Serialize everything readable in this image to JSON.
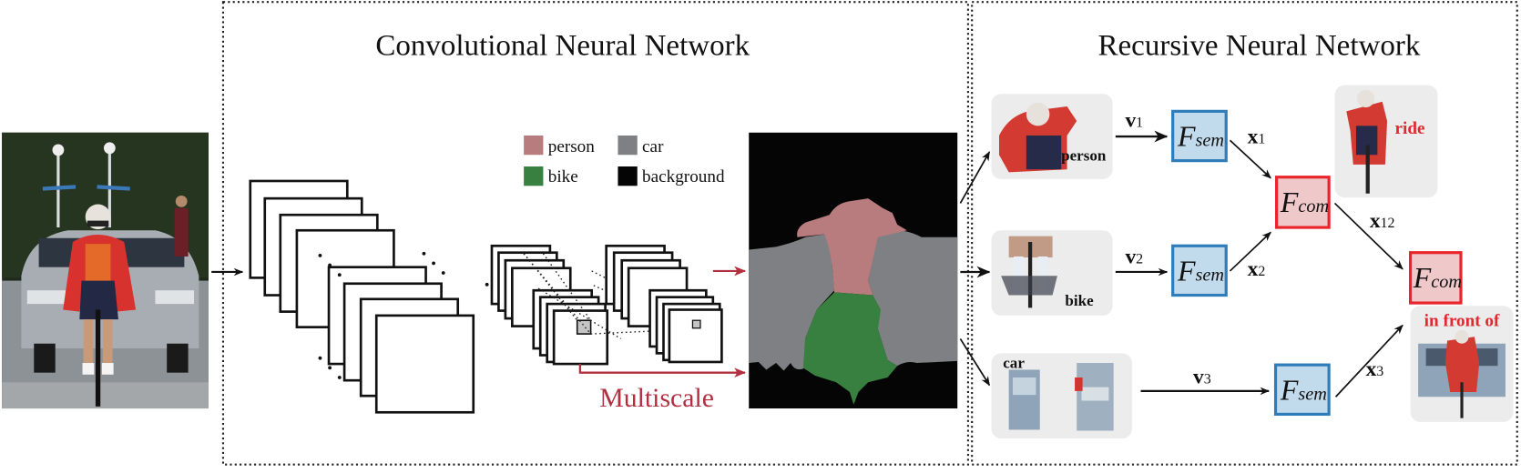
{
  "figure": {
    "cnn_panel": {
      "title": "Convolutional Neural Network",
      "multiscale_label": "Multiscale",
      "legend": [
        {
          "label": "person",
          "color": "#b87b7e"
        },
        {
          "label": "car",
          "color": "#7f8084"
        },
        {
          "label": "bike",
          "color": "#38803f"
        },
        {
          "label": "background",
          "color": "#050505"
        }
      ]
    },
    "rnn_panel": {
      "title": "Recursive Neural Network",
      "objects": [
        {
          "label": "person",
          "vector": "v",
          "vector_index": "1",
          "feature": "x",
          "feature_index": "1"
        },
        {
          "label": "bike",
          "vector": "v",
          "vector_index": "2",
          "feature": "x",
          "feature_index": "2"
        },
        {
          "label": "car",
          "vector": "v",
          "vector_index": "3",
          "feature": "x",
          "feature_index": "3"
        }
      ],
      "semantic_module": {
        "symbol": "F",
        "subscript": "sem"
      },
      "composition_module": {
        "symbol": "F",
        "subscript": "com"
      },
      "combined_feature": {
        "symbol": "x",
        "subscript": "12"
      },
      "relations": [
        {
          "label": "ride"
        },
        {
          "label": "in front of"
        }
      ]
    },
    "colors": {
      "sem_fill": "#c2dbec",
      "sem_stroke": "#2f7cba",
      "com_fill": "#efc8ca",
      "com_stroke": "#e8252b",
      "multiscale_red": "#b03040",
      "relation_red": "#e02a30",
      "crop_bg": "#ececec"
    }
  }
}
